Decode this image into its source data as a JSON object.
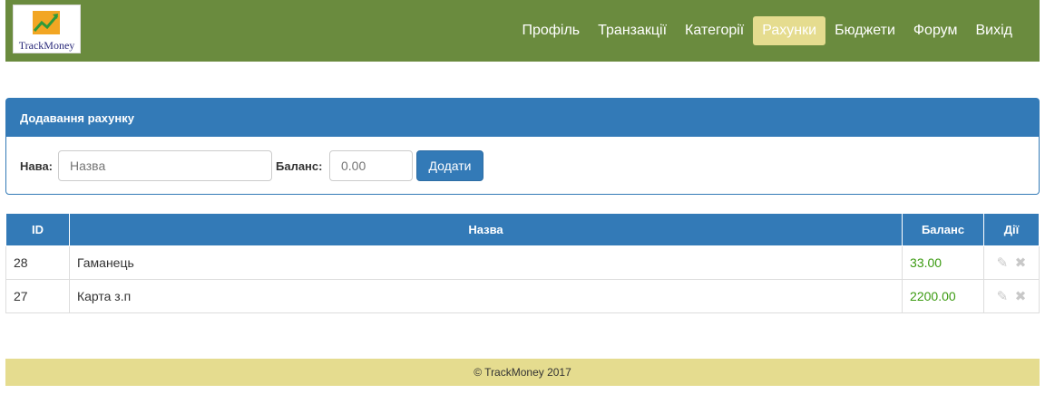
{
  "app": {
    "brand": "TrackMoney",
    "colors": {
      "navbar": "#6a8b3e",
      "accent": "#337ab7",
      "active_nav": "#e5dc8f",
      "balance": "#3c9b12"
    }
  },
  "nav": {
    "items": [
      {
        "label": "Профіль"
      },
      {
        "label": "Транзакції"
      },
      {
        "label": "Категорії"
      },
      {
        "label": "Рахунки",
        "active": true
      },
      {
        "label": "Бюджети"
      },
      {
        "label": "Форум"
      },
      {
        "label": "Вихід"
      }
    ]
  },
  "add_account": {
    "title": "Додавання рахунку",
    "name_label": "Нава:",
    "name_placeholder": "Назва",
    "balance_label": "Баланс:",
    "balance_placeholder": "0.00",
    "submit_label": "Додати"
  },
  "table": {
    "headers": {
      "id": "ID",
      "name": "Назва",
      "balance": "Баланс",
      "actions": "Дії"
    },
    "rows": [
      {
        "id": "28",
        "name": "Гаманець",
        "balance": "33.00"
      },
      {
        "id": "27",
        "name": "Карта з.п",
        "balance": "2200.00"
      }
    ],
    "action_icons": [
      "edit-icon",
      "delete-icon"
    ]
  },
  "footer": {
    "text": "© TrackMoney 2017"
  }
}
